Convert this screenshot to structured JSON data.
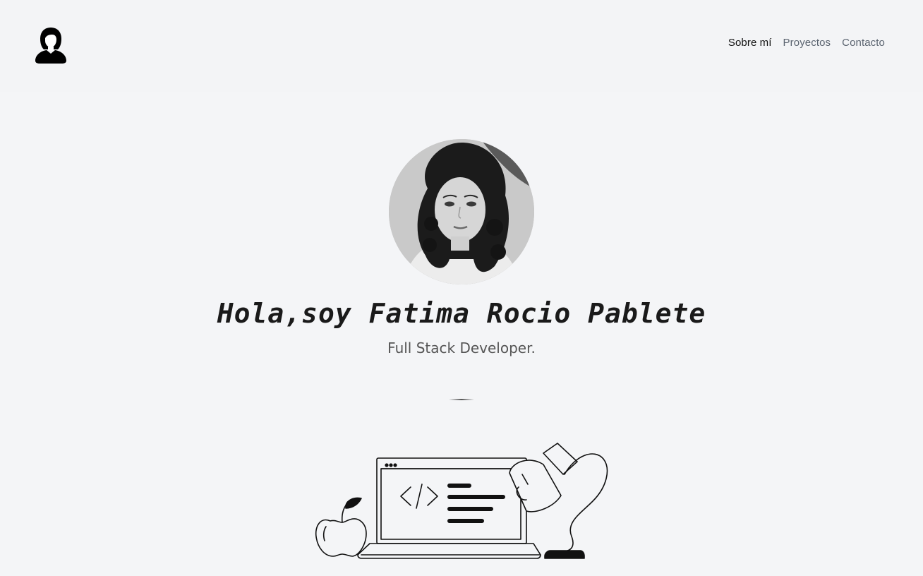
{
  "header": {
    "logo_icon": "woman-avatar-icon",
    "nav": [
      {
        "label": "Sobre mí",
        "active": true
      },
      {
        "label": "Proyectos",
        "active": false
      },
      {
        "label": "Contacto",
        "active": false
      }
    ]
  },
  "hero": {
    "title": "Hola,soy Fatima Rocio Pablete",
    "subtitle": "Full Stack Developer.",
    "photo_alt": "profile-photo"
  },
  "illustration": {
    "code_glyph": "</>"
  },
  "colors": {
    "background": "#f4f5f7",
    "text": "#1a1a1a",
    "nav_active": "#111111",
    "nav_inactive": "#5b6470"
  }
}
